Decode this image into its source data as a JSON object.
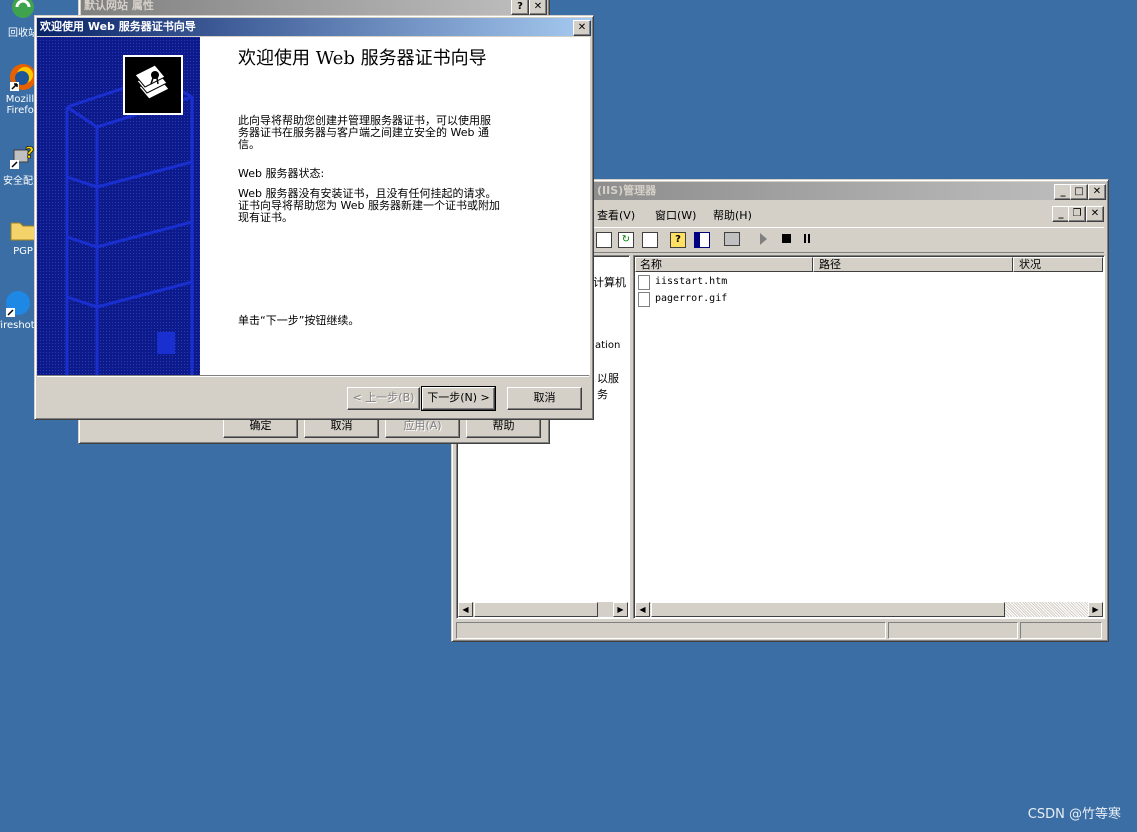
{
  "desktop": {
    "icons": [
      {
        "label": "回收站"
      },
      {
        "label": "Mozilla Firefox"
      },
      {
        "label": "安全配置"
      },
      {
        "label": "PGP"
      },
      {
        "label": "Fireshot"
      }
    ],
    "watermark": "CSDN @竹等寒"
  },
  "props_dialog": {
    "title": "默认网站 属性",
    "help_glyph": "?",
    "close_glyph": "✕",
    "buttons": {
      "ok": "确定",
      "cancel": "取消",
      "apply": "应用(A)",
      "help": "帮助"
    }
  },
  "iis_manager": {
    "title": "(IIS)管理器",
    "menu": {
      "view": "查看(V)",
      "window": "窗口(W)",
      "help": "帮助(H)"
    },
    "tree_fragments": [
      "计算机",
      "ation",
      "以服务"
    ],
    "columns": {
      "name": "名称",
      "path": "路径",
      "status": "状况"
    },
    "files": [
      {
        "name": "iisstart.htm"
      },
      {
        "name": "pagerror.gif"
      }
    ]
  },
  "wizard": {
    "title": "欢迎使用 Web 服务器证书向导",
    "heading": "欢迎使用 Web 服务器证书向导",
    "intro_line1": "此向导将帮助您创建并管理服务器证书，可以使用服",
    "intro_line2": "务器证书在服务器与客户端之间建立安全的 Web 通",
    "intro_line3": "信。",
    "status_label": "Web 服务器状态:",
    "status_line1": "Web 服务器没有安装证书，且没有任何挂起的请求。",
    "status_line2": "证书向导将帮助您为 Web 服务器新建一个证书或附加",
    "status_line3": "现有证书。",
    "continue_text": "单击“下一步”按钮继续。",
    "buttons": {
      "back": "< 上一步(B)",
      "next": "下一步(N) >",
      "cancel": "取消"
    },
    "close_glyph": "✕"
  }
}
